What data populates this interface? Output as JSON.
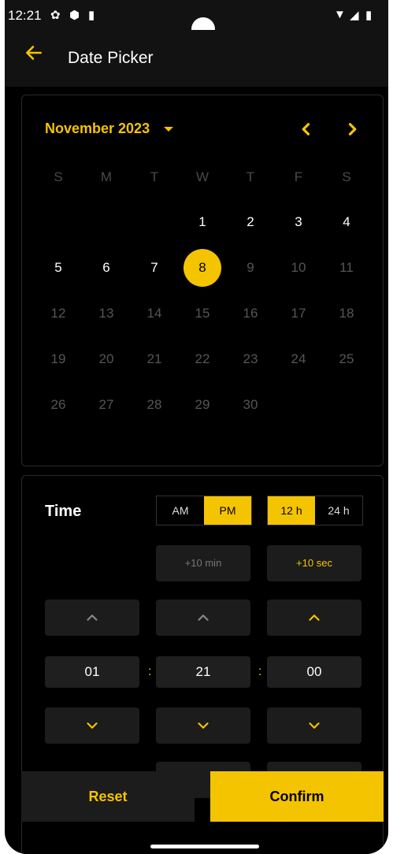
{
  "status_bar": {
    "time": "12:21"
  },
  "app_bar": {
    "title": "Date Picker"
  },
  "calendar": {
    "month_label": "November 2023",
    "weekdays": [
      "S",
      "M",
      "T",
      "W",
      "T",
      "F",
      "S"
    ],
    "days": [
      "1",
      "2",
      "3",
      "4",
      "5",
      "6",
      "7",
      "8",
      "9",
      "10",
      "11",
      "12",
      "13",
      "14",
      "15",
      "16",
      "17",
      "18",
      "19",
      "20",
      "21",
      "22",
      "23",
      "24",
      "25",
      "26",
      "27",
      "28",
      "29",
      "30"
    ],
    "first_weekday_index": 3,
    "selected_day": "8",
    "enabled_up_to": 8
  },
  "time": {
    "label": "Time",
    "am_label": "AM",
    "pm_label": "PM",
    "selected_period": "PM",
    "h12_label": "12 h",
    "h24_label": "24 h",
    "selected_format": "12 h",
    "plus10min_label": "+10 min",
    "plus10sec_label": "+10 sec",
    "hour": "01",
    "minute": "21",
    "second": "00",
    "separator": ":"
  },
  "buttons": {
    "reset": "Reset",
    "confirm": "Confirm"
  },
  "colors": {
    "accent": "#f5c400",
    "background": "#000000"
  }
}
